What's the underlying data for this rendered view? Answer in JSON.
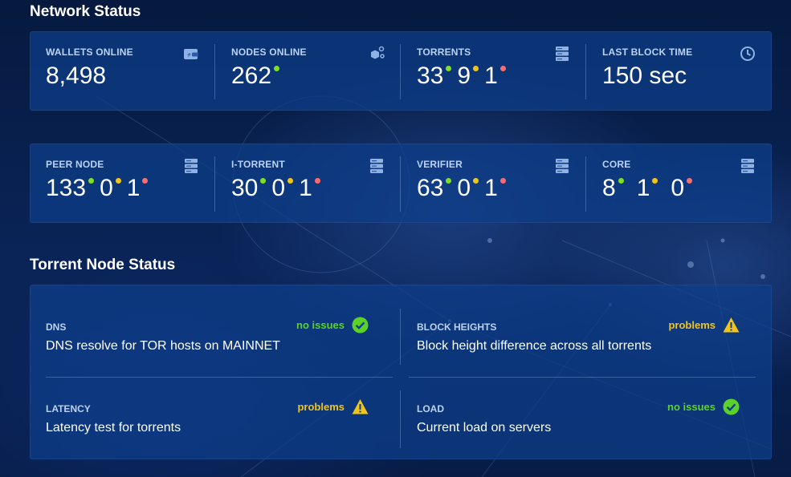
{
  "network": {
    "title": "Network Status",
    "top_stats": [
      {
        "label": "WALLETS ONLINE",
        "value": "8,498",
        "icon": "wallet-icon"
      },
      {
        "label": "NODES ONLINE",
        "value": "262",
        "icon": "nodes-icon"
      },
      {
        "label": "TORRENTS",
        "green": "33",
        "yellow": "9",
        "red": "1",
        "icon": "server-icon"
      },
      {
        "label": "LAST BLOCK TIME",
        "value": "150 sec",
        "icon": "clock-icon"
      }
    ],
    "node_stats": [
      {
        "label": "PEER NODE",
        "green": "133",
        "yellow": "0",
        "red": "1",
        "icon": "server-icon"
      },
      {
        "label": "I-TORRENT",
        "green": "30",
        "yellow": "0",
        "red": "1",
        "icon": "server-icon"
      },
      {
        "label": "VERIFIER",
        "green": "63",
        "yellow": "0",
        "red": "1",
        "icon": "server-icon"
      },
      {
        "label": "CORE",
        "green": "8",
        "yellow": "1",
        "red": "0",
        "icon": "server-icon"
      }
    ]
  },
  "torrent": {
    "title": "Torrent Node Status",
    "items": [
      {
        "label": "DNS",
        "desc": "DNS resolve for TOR hosts on MAINNET",
        "status": "no issues",
        "icon": "check-circle-icon"
      },
      {
        "label": "BLOCK HEIGHTS",
        "desc": "Block height difference across all torrents",
        "status": "problems",
        "icon": "warning-icon"
      },
      {
        "label": "LATENCY",
        "desc": "Latency test for torrents",
        "status": "problems",
        "icon": "warning-icon"
      },
      {
        "label": "LOAD",
        "desc": "Current load on servers",
        "status": "no issues",
        "icon": "check-circle-icon"
      }
    ]
  },
  "colors": {
    "ok": "#5bd22a",
    "warn": "#f2c418",
    "error": "#ff6a6a",
    "panel": "#0e3e8a"
  }
}
